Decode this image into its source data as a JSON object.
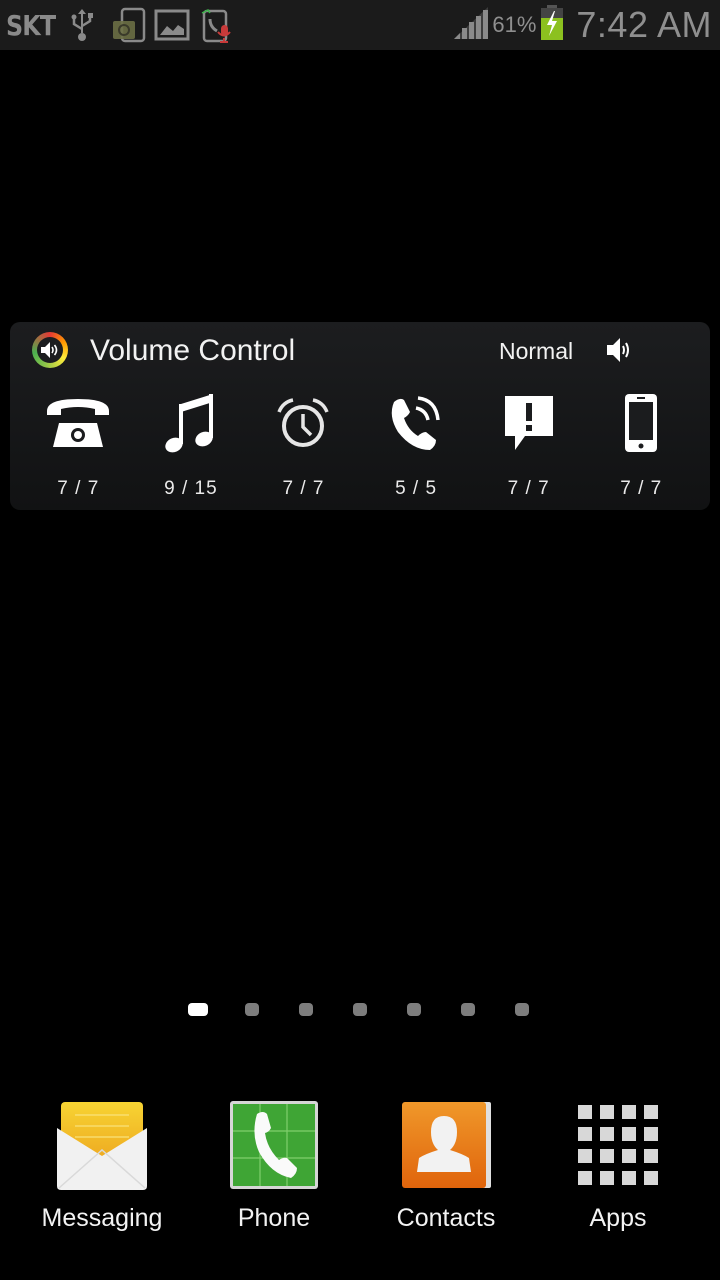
{
  "status_bar": {
    "carrier": "SKT",
    "icons": [
      "usb-icon",
      "screenshot-camera-icon",
      "gallery-icon",
      "call-recorder-icon"
    ],
    "signal_icon": "signal-bars-icon",
    "battery_percent": "61%",
    "battery_level": 0.61,
    "battery_charging": true,
    "time": "7:42 AM",
    "colors": {
      "battery_fill": "#8cc11f",
      "text": "#8f8f8f"
    }
  },
  "widget": {
    "title": "Volume Control",
    "mode": "Normal",
    "items": [
      {
        "icon": "ringtone-phone-icon",
        "value": "7 / 7"
      },
      {
        "icon": "music-note-icon",
        "value": "9 / 15"
      },
      {
        "icon": "alarm-clock-icon",
        "value": "7 / 7"
      },
      {
        "icon": "in-call-phone-icon",
        "value": "5 / 5"
      },
      {
        "icon": "notification-icon",
        "value": "7 / 7"
      },
      {
        "icon": "system-phone-icon",
        "value": "7 / 7"
      }
    ]
  },
  "pager": {
    "page_count": 7,
    "current_page": 1
  },
  "dock": {
    "items": [
      {
        "label": "Messaging",
        "icon": "messaging-icon",
        "color": "#f4c430"
      },
      {
        "label": "Phone",
        "icon": "phone-icon",
        "color": "#3fa535"
      },
      {
        "label": "Contacts",
        "icon": "contacts-icon",
        "color": "#e8781a"
      },
      {
        "label": "Apps",
        "icon": "apps-grid-icon",
        "color": "#d8d8d8"
      }
    ]
  }
}
